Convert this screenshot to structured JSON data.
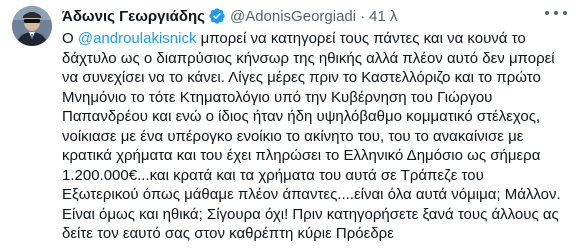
{
  "tweet": {
    "display_name": "Άδωνις Γεωργιάδης",
    "handle": "@AdonisGeorgiadi",
    "separator": "·",
    "timestamp": "41 λ",
    "verified_color": "#1d9bf0",
    "mention_color": "#1d9bf0",
    "icons": {
      "verified": "verified-badge-icon",
      "more": "more-options-icon"
    },
    "text": {
      "line1_prefix": "Ο ",
      "mention": "@androulakisnick",
      "line1_suffix": " μπορεί να κατηγορεί τους πάντες και να κουνά το",
      "line2": "δάχτυλο ως ο διαπρύσιος κήνσωρ της ηθικής αλλά πλέον αυτό δεν μπορεί",
      "line3": "να συνεχίσει να το κάνει. Λίγες μέρες πριν το Καστελλόριζο και το πρώτο",
      "line4": "Μνημόνιο το τότε Κτηματολόγιο υπό την Κυβέρνηση του Γιώργου",
      "line5": "Παπανδρέου και ενώ ο ίδιος ήταν ήδη υψηλόβαθμο κομματικό στέλεχος,",
      "line6": "νοίκιασε με ένα υπέρογκο ενοίκιο το ακίνητο του, του το ανακαίνισε με",
      "line7": "κρατικά χρήματα και του έχει πληρώσει το Ελληνικό Δημόσιο ως σήμερα",
      "line8": "1.200.000€...και κρατά και τα χρήματα του αυτά σε Τράπεζε του",
      "line9": "Εξωτερικού όπως μάθαμε πλέον άπαντες....είναι όλα αυτά νόμιμα; Μάλλον.",
      "line10": "Είναι όμως και ηθικά; Σίγουρα όχι! Πριν κατηγορήσετε ξανά τους άλλους ας",
      "line11": "δείτε τον εαυτό σας στον καθρέπτη κύριε Πρόεδρε"
    }
  }
}
